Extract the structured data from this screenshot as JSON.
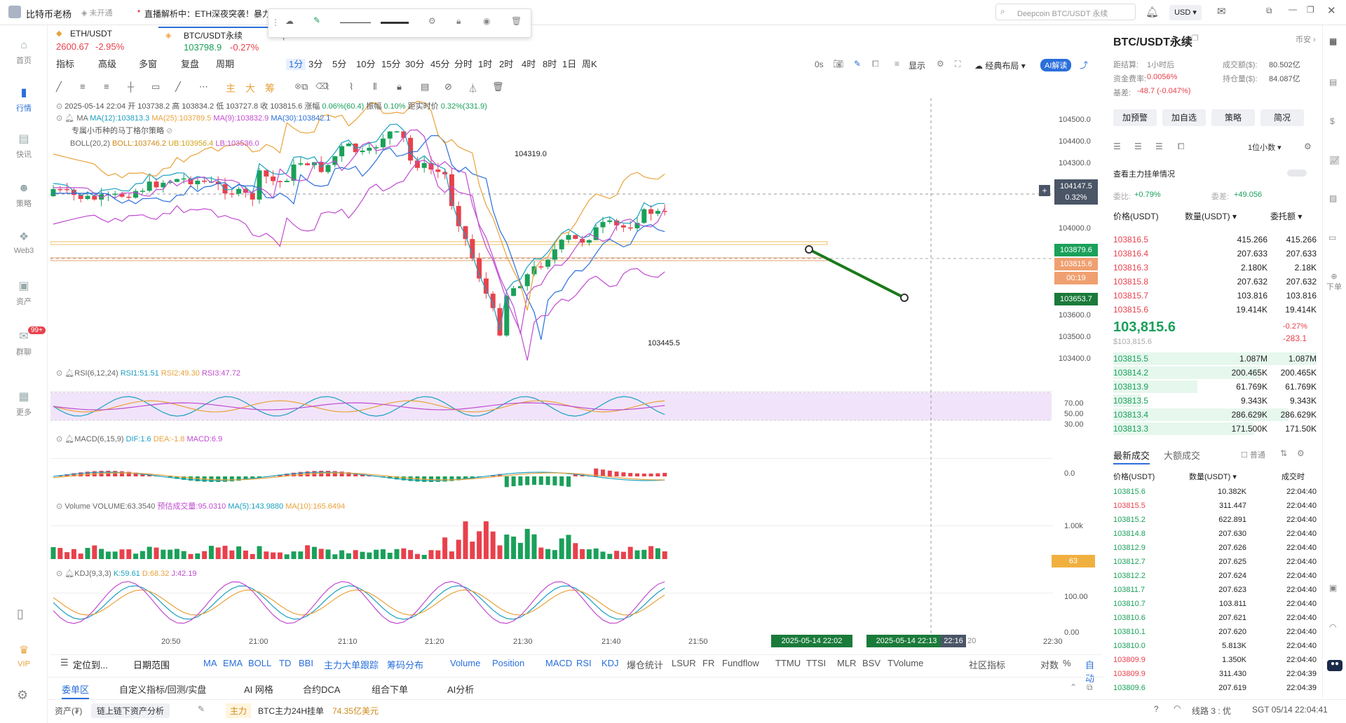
{
  "topbar": {
    "username": "比特币老杨",
    "unverified": "未开通",
    "news_dot": "•",
    "news": "直播解析中：ETH深夜突袭！暴力",
    "search_placeholder": "Deepcoin BTC/USDT 永续",
    "currency": "USD"
  },
  "leftnav": [
    {
      "label": "首页",
      "icon": "home-icon"
    },
    {
      "label": "行情",
      "icon": "chart-icon"
    },
    {
      "label": "快讯",
      "icon": "news-icon"
    },
    {
      "label": "策略",
      "icon": "robot-icon"
    },
    {
      "label": "Web3",
      "icon": "web3-icon"
    },
    {
      "label": "资产",
      "icon": "wallet-icon"
    },
    {
      "label": "群聊",
      "icon": "chat-icon",
      "badge": "99+"
    },
    {
      "label": "更多",
      "icon": "more-icon"
    },
    {
      "label": "VIP",
      "icon": "vip-icon"
    }
  ],
  "tabs": [
    {
      "name": "ETH/USDT",
      "price": "2600.67",
      "change": "-2.95%"
    },
    {
      "name": "BTC/USDT永续",
      "price": "103798.9",
      "change": "-0.27%"
    }
  ],
  "toolbar1": [
    "指标",
    "高级",
    "多窗",
    "复盘",
    "周期",
    "1分",
    "3分",
    "5分",
    "10分",
    "15分",
    "30分",
    "45分",
    "分时",
    "1时",
    "2时",
    "4时",
    "8时",
    "1日",
    "周K"
  ],
  "toolbar1_right": {
    "time": "0s",
    "display": "显示",
    "layout": "经典布局",
    "ai": "AI解读"
  },
  "toolbar2": [
    "主",
    "大",
    "筹"
  ],
  "ohlc": {
    "date": "2025-05-14 22:04",
    "open_label": "开",
    "open": "103738.2",
    "high_label": "高",
    "high": "103834.2",
    "low_label": "低",
    "low": "103727.8",
    "close_label": "收",
    "close": "103815.6",
    "chg_label": "涨幅",
    "chg": "0.06%(60.4)",
    "amp_label": "振幅",
    "amp": "0.10%",
    "dist_label": "距实时价",
    "dist": "0.32%(331.9)"
  },
  "ma": {
    "label": "MA",
    "ma12": "MA(12):103813.3",
    "ma25": "MA(25):103789.5",
    "ma9": "MA(9):103832.9",
    "ma30": "MA(30):103842.1"
  },
  "strategy": "专属小币种的马丁格尔策略",
  "boll": {
    "label": "BOLL(20,2)",
    "boll": "BOLL:103746.2",
    "ub": "UB:103956.4",
    "lb": "LB:103536.0"
  },
  "annot": {
    "high": "104319.0",
    "low": "103445.5"
  },
  "price_axis": [
    "104500.0",
    "104400.0",
    "104300.0",
    "104000.0",
    "103600.0",
    "103500.0",
    "103400.0"
  ],
  "price_tags": {
    "cross": "104147.5",
    "cross_pct": "0.32%",
    "t1": "103879.6",
    "t2": "103815.6",
    "t3": "00:19",
    "t4": "103653.7"
  },
  "rsi": {
    "label": "RSI(6,12,24)",
    "r1": "RSI1:51.51",
    "r2": "RSI2:49.30",
    "r3": "RSI3:47.72",
    "axis": [
      "70.00",
      "50.00",
      "30.00"
    ]
  },
  "macd": {
    "label": "MACD(6,15,9)",
    "dif": "DIF:1.6",
    "dea": "DEA:-1.8",
    "macd": "MACD:6.9",
    "axis": [
      "0.0"
    ]
  },
  "volume": {
    "label": "Volume",
    "vol": "VOLUME:63.3540",
    "pred": "预估成交量:95.0310",
    "ma5": "MA(5):143.9880",
    "ma10": "MA(10):165.6494",
    "axis": [
      "1.00k"
    ],
    "tag": "63"
  },
  "kdj": {
    "label": "KDJ(9,3,3)",
    "k": "K:59.61",
    "d": "D:68.32",
    "j": "J:42.19",
    "axis": [
      "100.00",
      "0.00"
    ]
  },
  "time_axis": [
    "20:50",
    "21:00",
    "21:10",
    "21:20",
    "21:30",
    "21:40",
    "21:50",
    "22:30"
  ],
  "time_tags": {
    "t1": "2025-05-14 22:02",
    "t2": "2025-05-14 22:13",
    "t3": "22:16",
    "t4": "20"
  },
  "indicator_bar": {
    "locate": "定位到...",
    "range": "日期范围",
    "items": [
      "MA",
      "EMA",
      "BOLL",
      "TD",
      "BBI",
      "主力大单跟踪",
      "筹码分布",
      "Volume",
      "Position",
      "MACD",
      "RSI",
      "KDJ",
      "爆仓统计",
      "LSUR",
      "FR",
      "Fundflow",
      "TTMU",
      "TTSI",
      "MLR",
      "BSV",
      "TVolume"
    ],
    "community": "社区指标",
    "right": [
      "对数",
      "%",
      "自动"
    ]
  },
  "bottom_tabs": [
    "委单区",
    "自定义指标/回测/实盘",
    "AI 网格",
    "合约DCA",
    "组合下单",
    "AI分析"
  ],
  "status": {
    "asset": "资产(₮)",
    "chain": "链上链下资产分析",
    "main": "主力",
    "main_text": "BTC主力24H挂单",
    "main_val": "74.35亿美元",
    "line": "线路 3 : 优",
    "time": "SGT 05/14 22:04:41"
  },
  "right": {
    "title": "BTC/USDT永续",
    "coin": "币安",
    "settle_label": "距结算:",
    "settle": "1小时后",
    "vol_label": "成交额($):",
    "vol": "80.502亿",
    "fund_label": "资金费率:",
    "fund": "0.0056%",
    "oi_label": "持仓量($):",
    "oi": "84.087亿",
    "basis_label": "基差:",
    "basis": "-48.7 (-0.047%)",
    "btns": [
      "加预警",
      "加自选",
      "策略",
      "简况"
    ],
    "decimals": "1位小数",
    "main_orders": "查看主力挂单情况",
    "ratio_label": "委比:",
    "ratio": "+0.79%",
    "diff_label": "委差:",
    "diff": "+49.056",
    "col_price": "价格(USDT)",
    "col_qty": "数量(USDT)",
    "col_total": "委托额",
    "asks": [
      [
        "103816.5",
        "415.266",
        "415.266"
      ],
      [
        "103816.4",
        "207.633",
        "207.633"
      ],
      [
        "103816.3",
        "2.180K",
        "2.18K"
      ],
      [
        "103815.8",
        "207.632",
        "207.632"
      ],
      [
        "103815.7",
        "103.816",
        "103.816"
      ],
      [
        "103815.6",
        "19.414K",
        "19.414K"
      ]
    ],
    "last": "103,815.6",
    "last_usd": "$103,815.6",
    "last_pct": "-0.27%",
    "last_chg": "-283.1",
    "bids": [
      [
        "103815.5",
        "1.087M",
        "1.087M"
      ],
      [
        "103814.2",
        "200.465K",
        "200.465K"
      ],
      [
        "103813.9",
        "61.769K",
        "61.769K"
      ],
      [
        "103813.5",
        "9.343K",
        "9.343K"
      ],
      [
        "103813.4",
        "286.629K",
        "286.629K"
      ],
      [
        "103813.3",
        "171.500K",
        "171.50K"
      ]
    ],
    "trades_tab": "最新成交",
    "big_tab": "大额成交",
    "normal": "普通",
    "tr_price": "价格(USDT)",
    "tr_qty": "数量(USDT)",
    "tr_time": "成交时",
    "trades": [
      [
        "103815.6",
        "10.382K",
        "22:04:40",
        "g"
      ],
      [
        "103815.5",
        "311.447",
        "22:04:40",
        "r"
      ],
      [
        "103815.2",
        "622.891",
        "22:04:40",
        "g"
      ],
      [
        "103814.8",
        "207.630",
        "22:04:40",
        "g"
      ],
      [
        "103812.9",
        "207.626",
        "22:04:40",
        "g"
      ],
      [
        "103812.7",
        "207.625",
        "22:04:40",
        "g"
      ],
      [
        "103812.2",
        "207.624",
        "22:04:40",
        "g"
      ],
      [
        "103811.7",
        "207.623",
        "22:04:40",
        "g"
      ],
      [
        "103810.7",
        "103.811",
        "22:04:40",
        "g"
      ],
      [
        "103810.6",
        "207.621",
        "22:04:40",
        "g"
      ],
      [
        "103810.1",
        "207.620",
        "22:04:40",
        "g"
      ],
      [
        "103810.0",
        "5.813K",
        "22:04:40",
        "g"
      ],
      [
        "103809.9",
        "1.350K",
        "22:04:40",
        "r"
      ],
      [
        "103809.9",
        "311.430",
        "22:04:39",
        "r"
      ],
      [
        "103809.6",
        "207.619",
        "22:04:39",
        "g"
      ]
    ]
  },
  "rightbar": [
    "下单"
  ]
}
